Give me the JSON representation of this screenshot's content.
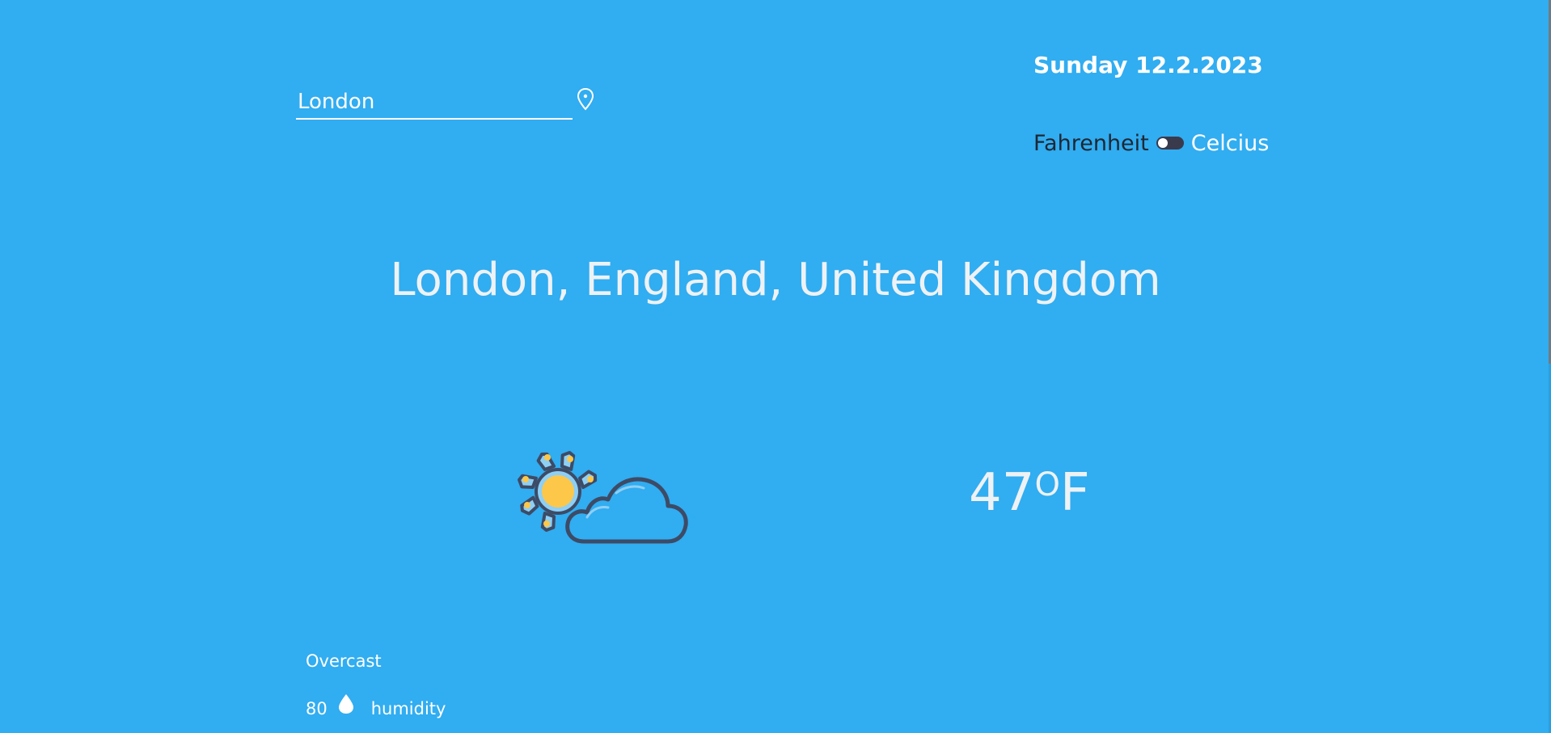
{
  "search": {
    "value": "London",
    "placeholder": ""
  },
  "icons": {
    "location": "map-pin-icon",
    "weather": "partly-cloudy-icon",
    "humidity": "water-drop-icon"
  },
  "header": {
    "date": "Sunday 12.2.2023",
    "unit_fahrenheit_label": "Fahrenheit",
    "unit_celsius_label": "Celcius"
  },
  "location": {
    "full_name": "London, England, United Kingdom"
  },
  "current": {
    "temperature": "47",
    "degree_symbol": "O",
    "unit": "F",
    "condition": "Overcast",
    "humidity_value": "80",
    "humidity_label": "humidity"
  },
  "colors": {
    "background": "#31adf1",
    "text": "#ffffff",
    "toggle": "#3a3a4d",
    "sun": "#fdc74a",
    "outline": "#3d4b66"
  }
}
